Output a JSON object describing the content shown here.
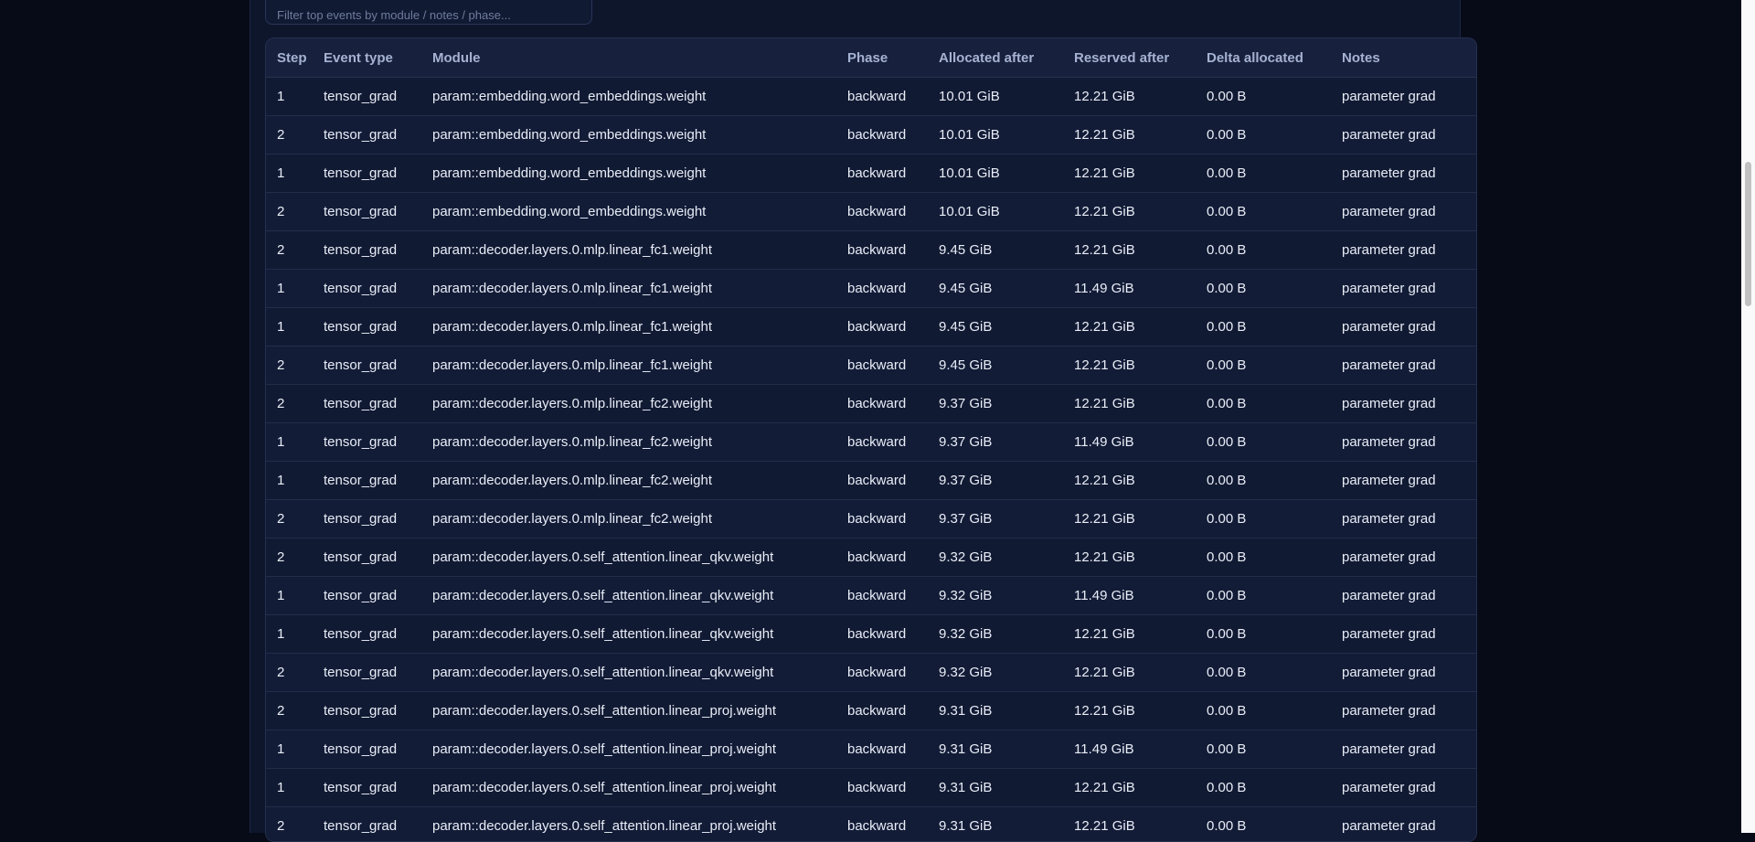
{
  "filter": {
    "placeholder": "Filter top events by module / notes / phase..."
  },
  "table": {
    "headers": [
      "Step",
      "Event type",
      "Module",
      "Phase",
      "Allocated after",
      "Reserved after",
      "Delta allocated",
      "Notes"
    ],
    "rows": [
      [
        "1",
        "tensor_grad",
        "param::embedding.word_embeddings.weight",
        "backward",
        "10.01 GiB",
        "12.21 GiB",
        "0.00 B",
        "parameter grad"
      ],
      [
        "2",
        "tensor_grad",
        "param::embedding.word_embeddings.weight",
        "backward",
        "10.01 GiB",
        "12.21 GiB",
        "0.00 B",
        "parameter grad"
      ],
      [
        "1",
        "tensor_grad",
        "param::embedding.word_embeddings.weight",
        "backward",
        "10.01 GiB",
        "12.21 GiB",
        "0.00 B",
        "parameter grad"
      ],
      [
        "2",
        "tensor_grad",
        "param::embedding.word_embeddings.weight",
        "backward",
        "10.01 GiB",
        "12.21 GiB",
        "0.00 B",
        "parameter grad"
      ],
      [
        "2",
        "tensor_grad",
        "param::decoder.layers.0.mlp.linear_fc1.weight",
        "backward",
        "9.45 GiB",
        "12.21 GiB",
        "0.00 B",
        "parameter grad"
      ],
      [
        "1",
        "tensor_grad",
        "param::decoder.layers.0.mlp.linear_fc1.weight",
        "backward",
        "9.45 GiB",
        "11.49 GiB",
        "0.00 B",
        "parameter grad"
      ],
      [
        "1",
        "tensor_grad",
        "param::decoder.layers.0.mlp.linear_fc1.weight",
        "backward",
        "9.45 GiB",
        "12.21 GiB",
        "0.00 B",
        "parameter grad"
      ],
      [
        "2",
        "tensor_grad",
        "param::decoder.layers.0.mlp.linear_fc1.weight",
        "backward",
        "9.45 GiB",
        "12.21 GiB",
        "0.00 B",
        "parameter grad"
      ],
      [
        "2",
        "tensor_grad",
        "param::decoder.layers.0.mlp.linear_fc2.weight",
        "backward",
        "9.37 GiB",
        "12.21 GiB",
        "0.00 B",
        "parameter grad"
      ],
      [
        "1",
        "tensor_grad",
        "param::decoder.layers.0.mlp.linear_fc2.weight",
        "backward",
        "9.37 GiB",
        "11.49 GiB",
        "0.00 B",
        "parameter grad"
      ],
      [
        "1",
        "tensor_grad",
        "param::decoder.layers.0.mlp.linear_fc2.weight",
        "backward",
        "9.37 GiB",
        "12.21 GiB",
        "0.00 B",
        "parameter grad"
      ],
      [
        "2",
        "tensor_grad",
        "param::decoder.layers.0.mlp.linear_fc2.weight",
        "backward",
        "9.37 GiB",
        "12.21 GiB",
        "0.00 B",
        "parameter grad"
      ],
      [
        "2",
        "tensor_grad",
        "param::decoder.layers.0.self_attention.linear_qkv.weight",
        "backward",
        "9.32 GiB",
        "12.21 GiB",
        "0.00 B",
        "parameter grad"
      ],
      [
        "1",
        "tensor_grad",
        "param::decoder.layers.0.self_attention.linear_qkv.weight",
        "backward",
        "9.32 GiB",
        "11.49 GiB",
        "0.00 B",
        "parameter grad"
      ],
      [
        "1",
        "tensor_grad",
        "param::decoder.layers.0.self_attention.linear_qkv.weight",
        "backward",
        "9.32 GiB",
        "12.21 GiB",
        "0.00 B",
        "parameter grad"
      ],
      [
        "2",
        "tensor_grad",
        "param::decoder.layers.0.self_attention.linear_qkv.weight",
        "backward",
        "9.32 GiB",
        "12.21 GiB",
        "0.00 B",
        "parameter grad"
      ],
      [
        "2",
        "tensor_grad",
        "param::decoder.layers.0.self_attention.linear_proj.weight",
        "backward",
        "9.31 GiB",
        "12.21 GiB",
        "0.00 B",
        "parameter grad"
      ],
      [
        "1",
        "tensor_grad",
        "param::decoder.layers.0.self_attention.linear_proj.weight",
        "backward",
        "9.31 GiB",
        "11.49 GiB",
        "0.00 B",
        "parameter grad"
      ],
      [
        "1",
        "tensor_grad",
        "param::decoder.layers.0.self_attention.linear_proj.weight",
        "backward",
        "9.31 GiB",
        "12.21 GiB",
        "0.00 B",
        "parameter grad"
      ],
      [
        "2",
        "tensor_grad",
        "param::decoder.layers.0.self_attention.linear_proj.weight",
        "backward",
        "9.31 GiB",
        "12.21 GiB",
        "0.00 B",
        "parameter grad"
      ]
    ]
  }
}
